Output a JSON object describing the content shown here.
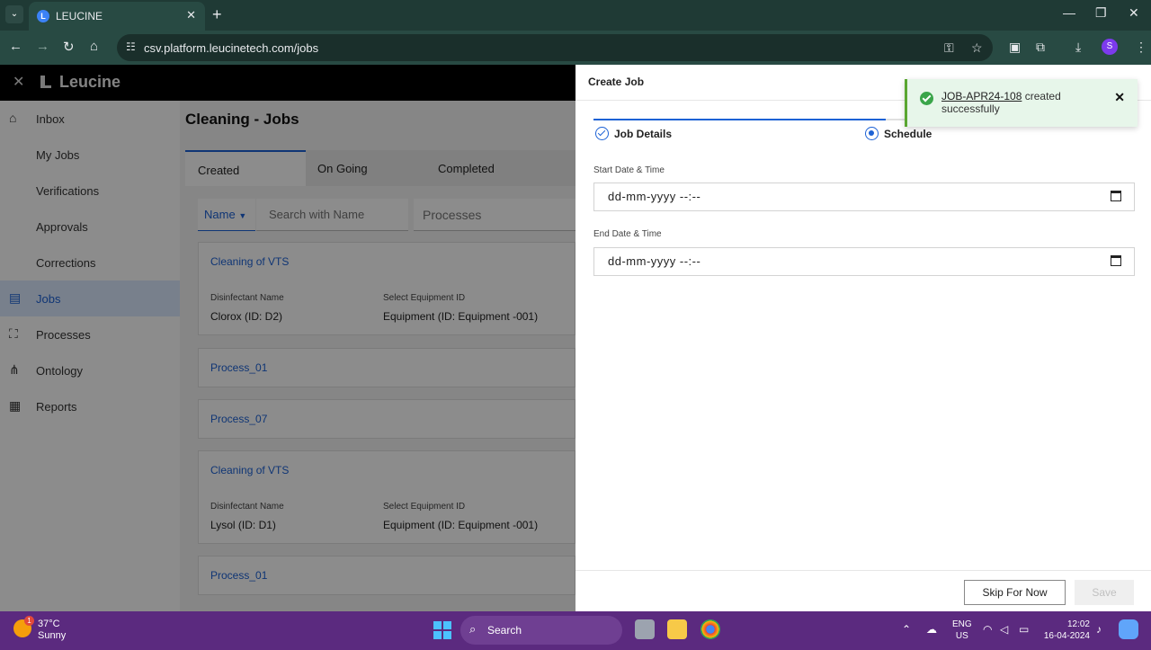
{
  "browser": {
    "tab_title": "LEUCINE",
    "url": "csv.platform.leucinetech.com/jobs",
    "profile_initial": "S"
  },
  "app": {
    "logo_text": "Leucine",
    "sidebar": [
      {
        "label": "Inbox",
        "icon": "inbox-icon"
      },
      {
        "label": "My Jobs",
        "icon": ""
      },
      {
        "label": "Verifications",
        "icon": ""
      },
      {
        "label": "Approvals",
        "icon": ""
      },
      {
        "label": "Corrections",
        "icon": ""
      },
      {
        "label": "Jobs",
        "icon": "clipboard-icon",
        "active": true
      },
      {
        "label": "Processes",
        "icon": "flow-icon"
      },
      {
        "label": "Ontology",
        "icon": "hierarchy-icon"
      },
      {
        "label": "Reports",
        "icon": "report-icon"
      }
    ],
    "page_title": "Cleaning - Jobs",
    "tabs": [
      "Created",
      "On Going",
      "Completed"
    ],
    "filter_name": "Name",
    "search_placeholder": "Search with Name",
    "processes_placeholder": "Processes",
    "cards": [
      {
        "title": "Cleaning of VTS",
        "label1": "Disinfectant Name",
        "value1": "Clorox (ID: D2)",
        "label2": "Select Equipment ID",
        "value2": "Equipment (ID: Equipment -001)"
      },
      {
        "title": "Process_01"
      },
      {
        "title": "Process_07"
      },
      {
        "title": "Cleaning of VTS",
        "label1": "Disinfectant Name",
        "value1": "Lysol (ID: D1)",
        "label2": "Select Equipment ID",
        "value2": "Equipment (ID: Equipment -001)"
      },
      {
        "title": "Process_01"
      }
    ]
  },
  "drawer": {
    "title": "Create Job",
    "step1": "Job Details",
    "step2": "Schedule",
    "start_label": "Start Date & Time",
    "start_value": "dd-mm-yyyy --:--",
    "end_label": "End Date & Time",
    "end_value": "dd-mm-yyyy --:--",
    "skip_label": "Skip For Now",
    "save_label": "Save"
  },
  "toast": {
    "job_id": "JOB-APR24-108",
    "message": "created successfully"
  },
  "taskbar": {
    "temp": "37°C",
    "weather": "Sunny",
    "badge": "1",
    "search_label": "Search",
    "lang1": "ENG",
    "lang2": "US",
    "time": "12:02",
    "date": "16-04-2024"
  },
  "colors": {
    "accent": "#1d62d5",
    "browser_bar": "#284a43",
    "taskbar": "#5b2a7f",
    "toast_bg": "#e7f6ea"
  }
}
